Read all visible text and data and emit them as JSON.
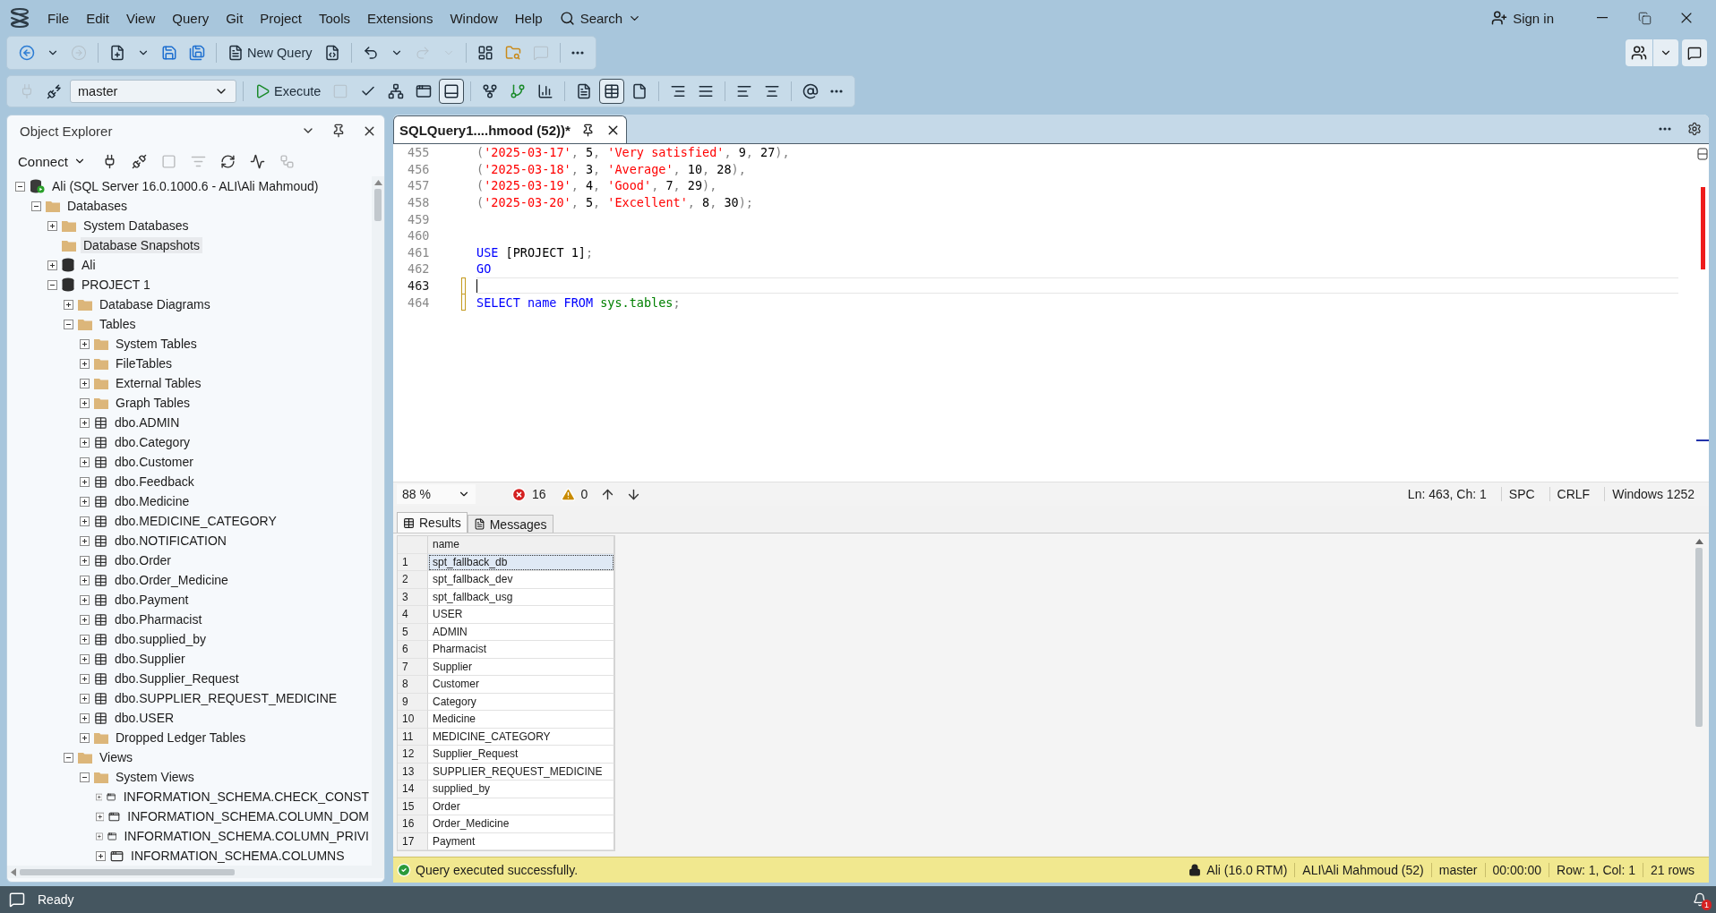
{
  "window": {
    "menu": [
      "File",
      "Edit",
      "View",
      "Query",
      "Git",
      "Project",
      "Tools",
      "Extensions",
      "Window",
      "Help"
    ],
    "search": "Search",
    "sign_in": "Sign in"
  },
  "toolbar_main": [
    {
      "kind": "back",
      "disabled": false
    },
    {
      "kind": "dropdown",
      "disabled": false
    },
    {
      "kind": "forward",
      "disabled": true
    },
    {
      "kind": "separator"
    },
    {
      "kind": "new-file",
      "disabled": false
    },
    {
      "kind": "dropdown",
      "disabled": false
    },
    {
      "kind": "save",
      "disabled": false
    },
    {
      "kind": "save-all",
      "disabled": false
    },
    {
      "kind": "separator"
    },
    {
      "kind": "new-query",
      "label": "New Query",
      "disabled": false
    },
    {
      "kind": "query-file",
      "disabled": false
    },
    {
      "kind": "separator"
    },
    {
      "kind": "undo",
      "disabled": false
    },
    {
      "kind": "dropdown",
      "disabled": false
    },
    {
      "kind": "redo",
      "disabled": true
    },
    {
      "kind": "dropdown",
      "disabled": true
    },
    {
      "kind": "separator"
    },
    {
      "kind": "monitor",
      "disabled": false
    },
    {
      "kind": "folder-search",
      "disabled": false
    },
    {
      "kind": "copilot",
      "disabled": true
    },
    {
      "kind": "separator"
    },
    {
      "kind": "more",
      "disabled": false
    }
  ],
  "toolbar_query": [
    {
      "kind": "plug",
      "disabled": true
    },
    {
      "kind": "connection",
      "disabled": false
    },
    {
      "kind": "database-select",
      "value": "master"
    },
    {
      "kind": "separator"
    },
    {
      "kind": "execute",
      "label": "Execute",
      "disabled": false
    },
    {
      "kind": "stop",
      "disabled": true
    },
    {
      "kind": "parse",
      "disabled": false
    },
    {
      "kind": "plan",
      "disabled": false
    },
    {
      "kind": "window",
      "disabled": false
    },
    {
      "kind": "pane",
      "disabled": false,
      "pressed": true
    },
    {
      "kind": "separator"
    },
    {
      "kind": "live",
      "disabled": false
    },
    {
      "kind": "include-plan",
      "disabled": false
    },
    {
      "kind": "stats",
      "disabled": false
    },
    {
      "kind": "separator"
    },
    {
      "kind": "text",
      "disabled": false
    },
    {
      "kind": "grid",
      "disabled": false,
      "pressed": true
    },
    {
      "kind": "file",
      "disabled": false
    },
    {
      "kind": "separator"
    },
    {
      "kind": "comment",
      "disabled": false
    },
    {
      "kind": "uncomment",
      "disabled": false
    },
    {
      "kind": "separator"
    },
    {
      "kind": "outdent",
      "disabled": false
    },
    {
      "kind": "indent",
      "disabled": false
    },
    {
      "kind": "separator"
    },
    {
      "kind": "params",
      "disabled": false
    },
    {
      "kind": "more",
      "disabled": false
    }
  ],
  "object_explorer": {
    "title": "Object Explorer",
    "connect": "Connect",
    "tools": [
      {
        "kind": "connect",
        "disabled": false
      },
      {
        "kind": "disconnect",
        "disabled": false
      },
      {
        "kind": "stop",
        "disabled": true
      },
      {
        "kind": "filter",
        "disabled": true
      },
      {
        "kind": "refresh",
        "disabled": false
      },
      {
        "kind": "activity",
        "disabled": false
      },
      {
        "kind": "diagram",
        "disabled": true
      }
    ],
    "tree": [
      {
        "label": "Ali (SQL Server 16.0.1000.6 - ALI\\Ali Mahmoud)",
        "kind": "server",
        "expanded": true,
        "selected": false,
        "children": [
          {
            "label": "Databases",
            "kind": "folder",
            "expanded": true,
            "selected": false,
            "children": [
              {
                "label": "System Databases",
                "kind": "folder",
                "expanded": false,
                "selected": false
              },
              {
                "label": "Database Snapshots",
                "kind": "folder",
                "selected": true
              },
              {
                "label": "Ali",
                "kind": "database",
                "expanded": false,
                "selected": false
              },
              {
                "label": "PROJECT 1",
                "kind": "database",
                "expanded": true,
                "selected": false,
                "children": [
                  {
                    "label": "Database Diagrams",
                    "kind": "folder",
                    "expanded": false,
                    "selected": false
                  },
                  {
                    "label": "Tables",
                    "kind": "folder",
                    "expanded": true,
                    "selected": false,
                    "children": [
                      {
                        "label": "System Tables",
                        "kind": "folder",
                        "expanded": false,
                        "selected": false
                      },
                      {
                        "label": "FileTables",
                        "kind": "folder",
                        "expanded": false,
                        "selected": false
                      },
                      {
                        "label": "External Tables",
                        "kind": "folder",
                        "expanded": false,
                        "selected": false
                      },
                      {
                        "label": "Graph Tables",
                        "kind": "folder",
                        "expanded": false,
                        "selected": false
                      },
                      {
                        "label": "dbo.ADMIN",
                        "kind": "table",
                        "expanded": false,
                        "selected": false
                      },
                      {
                        "label": "dbo.Category",
                        "kind": "table",
                        "expanded": false,
                        "selected": false
                      },
                      {
                        "label": "dbo.Customer",
                        "kind": "table",
                        "expanded": false,
                        "selected": false
                      },
                      {
                        "label": "dbo.Feedback",
                        "kind": "table",
                        "expanded": false,
                        "selected": false
                      },
                      {
                        "label": "dbo.Medicine",
                        "kind": "table",
                        "expanded": false,
                        "selected": false
                      },
                      {
                        "label": "dbo.MEDICINE_CATEGORY",
                        "kind": "table",
                        "expanded": false,
                        "selected": false
                      },
                      {
                        "label": "dbo.NOTIFICATION",
                        "kind": "table",
                        "expanded": false,
                        "selected": false
                      },
                      {
                        "label": "dbo.Order",
                        "kind": "table",
                        "expanded": false,
                        "selected": false
                      },
                      {
                        "label": "dbo.Order_Medicine",
                        "kind": "table",
                        "expanded": false,
                        "selected": false
                      },
                      {
                        "label": "dbo.Payment",
                        "kind": "table",
                        "expanded": false,
                        "selected": false
                      },
                      {
                        "label": "dbo.Pharmacist",
                        "kind": "table",
                        "expanded": false,
                        "selected": false
                      },
                      {
                        "label": "dbo.supplied_by",
                        "kind": "table",
                        "expanded": false,
                        "selected": false
                      },
                      {
                        "label": "dbo.Supplier",
                        "kind": "table",
                        "expanded": false,
                        "selected": false
                      },
                      {
                        "label": "dbo.Supplier_Request",
                        "kind": "table",
                        "expanded": false,
                        "selected": false
                      },
                      {
                        "label": "dbo.SUPPLIER_REQUEST_MEDICINE",
                        "kind": "table",
                        "expanded": false,
                        "selected": false
                      },
                      {
                        "label": "dbo.USER",
                        "kind": "table",
                        "expanded": false,
                        "selected": false
                      },
                      {
                        "label": "Dropped Ledger Tables",
                        "kind": "folder",
                        "expanded": false,
                        "selected": false
                      }
                    ]
                  },
                  {
                    "label": "Views",
                    "kind": "folder",
                    "expanded": true,
                    "selected": false,
                    "children": [
                      {
                        "label": "System Views",
                        "kind": "folder",
                        "expanded": true,
                        "selected": false,
                        "children": [
                          {
                            "label": "INFORMATION_SCHEMA.CHECK_CONST",
                            "kind": "view",
                            "expanded": false,
                            "selected": false
                          },
                          {
                            "label": "INFORMATION_SCHEMA.COLUMN_DOM",
                            "kind": "view",
                            "expanded": false,
                            "selected": false
                          },
                          {
                            "label": "INFORMATION_SCHEMA.COLUMN_PRIVI",
                            "kind": "view",
                            "expanded": false,
                            "selected": false
                          },
                          {
                            "label": "INFORMATION_SCHEMA.COLUMNS",
                            "kind": "view",
                            "expanded": false,
                            "selected": false
                          }
                        ]
                      }
                    ]
                  }
                ]
              }
            ]
          }
        ]
      }
    ]
  },
  "editor": {
    "tab": {
      "title": "SQLQuery1....hmood (52))*",
      "selected": true
    },
    "lines": [
      {
        "number": "455",
        "changed": false,
        "current": false,
        "tokens": [
          {
            "text": "(",
            "kind": "punct"
          },
          {
            "text": "'2025-03-17'",
            "kind": "string"
          },
          {
            "text": ", ",
            "kind": "punct"
          },
          {
            "text": "5",
            "kind": "plain"
          },
          {
            "text": ", ",
            "kind": "punct"
          },
          {
            "text": "'Very satisfied'",
            "kind": "string"
          },
          {
            "text": ", ",
            "kind": "punct"
          },
          {
            "text": "9",
            "kind": "plain"
          },
          {
            "text": ", ",
            "kind": "punct"
          },
          {
            "text": "27",
            "kind": "plain"
          },
          {
            "text": "),",
            "kind": "punct"
          }
        ]
      },
      {
        "number": "456",
        "changed": false,
        "current": false,
        "tokens": [
          {
            "text": "(",
            "kind": "punct"
          },
          {
            "text": "'2025-03-18'",
            "kind": "string"
          },
          {
            "text": ", ",
            "kind": "punct"
          },
          {
            "text": "3",
            "kind": "plain"
          },
          {
            "text": ", ",
            "kind": "punct"
          },
          {
            "text": "'Average'",
            "kind": "string"
          },
          {
            "text": ", ",
            "kind": "punct"
          },
          {
            "text": "10",
            "kind": "plain"
          },
          {
            "text": ", ",
            "kind": "punct"
          },
          {
            "text": "28",
            "kind": "plain"
          },
          {
            "text": "),",
            "kind": "punct"
          }
        ]
      },
      {
        "number": "457",
        "changed": false,
        "current": false,
        "tokens": [
          {
            "text": "(",
            "kind": "punct"
          },
          {
            "text": "'2025-03-19'",
            "kind": "string"
          },
          {
            "text": ", ",
            "kind": "punct"
          },
          {
            "text": "4",
            "kind": "plain"
          },
          {
            "text": ", ",
            "kind": "punct"
          },
          {
            "text": "'Good'",
            "kind": "string"
          },
          {
            "text": ", ",
            "kind": "punct"
          },
          {
            "text": "7",
            "kind": "plain"
          },
          {
            "text": ", ",
            "kind": "punct"
          },
          {
            "text": "29",
            "kind": "plain"
          },
          {
            "text": "),",
            "kind": "punct"
          }
        ]
      },
      {
        "number": "458",
        "changed": false,
        "current": false,
        "tokens": [
          {
            "text": "(",
            "kind": "punct"
          },
          {
            "text": "'2025-03-20'",
            "kind": "string"
          },
          {
            "text": ", ",
            "kind": "punct"
          },
          {
            "text": "5",
            "kind": "plain"
          },
          {
            "text": ", ",
            "kind": "punct"
          },
          {
            "text": "'Excellent'",
            "kind": "string"
          },
          {
            "text": ", ",
            "kind": "punct"
          },
          {
            "text": "8",
            "kind": "plain"
          },
          {
            "text": ", ",
            "kind": "punct"
          },
          {
            "text": "30",
            "kind": "plain"
          },
          {
            "text": ");",
            "kind": "punct"
          }
        ]
      },
      {
        "number": "459",
        "changed": false,
        "current": false
      },
      {
        "number": "460",
        "changed": false,
        "current": false
      },
      {
        "number": "461",
        "changed": false,
        "current": false,
        "tokens": [
          {
            "text": "USE",
            "kind": "keyword"
          },
          {
            "text": " [PROJECT 1]",
            "kind": "plain"
          },
          {
            "text": ";",
            "kind": "punct"
          }
        ]
      },
      {
        "number": "462",
        "changed": false,
        "current": false,
        "tokens": [
          {
            "text": "GO",
            "kind": "keyword"
          }
        ]
      },
      {
        "number": "463",
        "changed": true,
        "current": true
      },
      {
        "number": "464",
        "changed": true,
        "current": false,
        "tokens": [
          {
            "text": "SELECT",
            "kind": "keyword"
          },
          {
            "text": " name",
            "kind": "keyword"
          },
          {
            "text": " FROM",
            "kind": "keyword"
          },
          {
            "text": " sys.tables",
            "kind": "system"
          },
          {
            "text": ";",
            "kind": "punct"
          }
        ]
      }
    ]
  },
  "zoom_bar": {
    "zoom": "88 %",
    "errors": "16",
    "warnings": "0",
    "position": "Ln: 463, Ch: 1",
    "indent": "SPC",
    "line_endings": "CRLF",
    "encoding": "Windows 1252"
  },
  "results": {
    "tabs": [
      {
        "label": "Results",
        "selected": true
      },
      {
        "label": "Messages",
        "selected": false
      }
    ],
    "columns": [
      "name"
    ],
    "rows": [
      {
        "number": "1",
        "name": "spt_fallback_db",
        "selected": true
      },
      {
        "number": "2",
        "name": "spt_fallback_dev",
        "selected": false
      },
      {
        "number": "3",
        "name": "spt_fallback_usg",
        "selected": false
      },
      {
        "number": "4",
        "name": "USER",
        "selected": false
      },
      {
        "number": "5",
        "name": "ADMIN",
        "selected": false
      },
      {
        "number": "6",
        "name": "Pharmacist",
        "selected": false
      },
      {
        "number": "7",
        "name": "Supplier",
        "selected": false
      },
      {
        "number": "8",
        "name": "Customer",
        "selected": false
      },
      {
        "number": "9",
        "name": "Category",
        "selected": false
      },
      {
        "number": "10",
        "name": "Medicine",
        "selected": false
      },
      {
        "number": "11",
        "name": "MEDICINE_CATEGORY",
        "selected": false
      },
      {
        "number": "12",
        "name": "Supplier_Request",
        "selected": false
      },
      {
        "number": "13",
        "name": "SUPPLIER_REQUEST_MEDICINE",
        "selected": false
      },
      {
        "number": "14",
        "name": "supplied_by",
        "selected": false
      },
      {
        "number": "15",
        "name": "Order",
        "selected": false
      },
      {
        "number": "16",
        "name": "Order_Medicine",
        "selected": false
      },
      {
        "number": "17",
        "name": "Payment",
        "selected": false
      }
    ]
  },
  "query_status": {
    "message": "Query executed successfully.",
    "server": "Ali (16.0 RTM)",
    "user": "ALI\\Ali Mahmoud (52)",
    "database": "master",
    "elapsed": "00:00:00",
    "cursor": "Row: 1, Col: 1",
    "row_count": "21 rows"
  },
  "status_bar": {
    "text": "Ready",
    "notifications": "1"
  }
}
